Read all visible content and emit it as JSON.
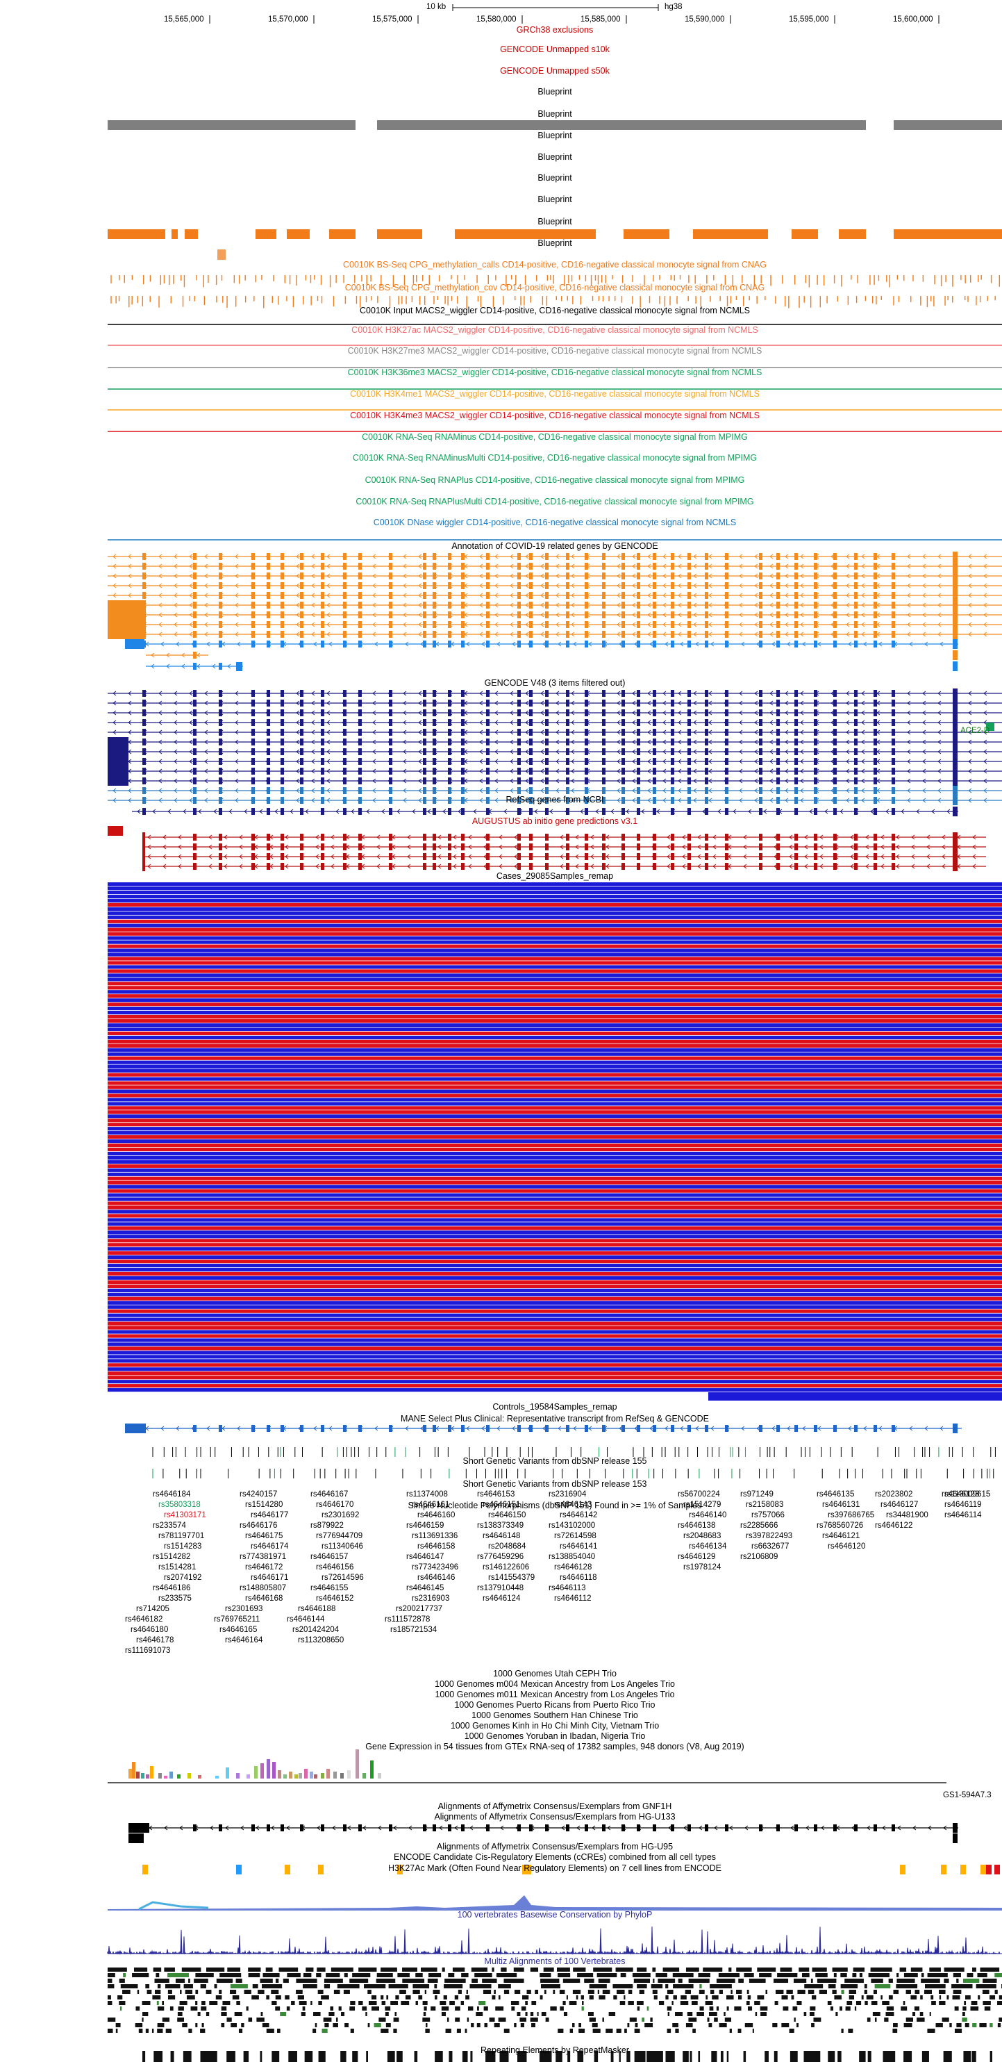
{
  "ruler": {
    "scale_label": "10 kb",
    "assembly": "hg38",
    "ticks": [
      "15,565,000",
      "15,570,000",
      "15,575,000",
      "15,580,000",
      "15,585,000",
      "15,590,000",
      "15,595,000",
      "15,600,000"
    ]
  },
  "tracks": [
    {
      "label": "GRCh38 exclusions",
      "color": "#cc0000"
    },
    {
      "label": "GENCODE Unmapped s10k",
      "color": "#cc0000"
    },
    {
      "label": "GENCODE Unmapped s50k",
      "color": "#cc0000"
    },
    {
      "label": "Blueprint",
      "color": "#000000"
    },
    {
      "label": "Blueprint",
      "color": "#000000"
    },
    {
      "label": "Blueprint",
      "color": "#000000"
    },
    {
      "label": "Blueprint",
      "color": "#000000"
    },
    {
      "label": "Blueprint",
      "color": "#000000"
    },
    {
      "label": "Blueprint",
      "color": "#000000"
    },
    {
      "label": "Blueprint",
      "color": "#000000"
    },
    {
      "label": "Blueprint",
      "color": "#000000"
    },
    {
      "label": "C0010K BS-Seq CPG_methylation_calls CD14-positive, CD16-negative classical monocyte signal from CNAG",
      "color": "#f07a1a"
    },
    {
      "label": "C0010K BS-Seq CPG_methylation_cov CD14-positive, CD16-negative classical monocyte signal from CNAG",
      "color": "#f07a1a"
    },
    {
      "label": "C0010K Input MACS2_wiggler CD14-positive, CD16-negative classical monocyte signal from NCMLS",
      "color": "#000000"
    },
    {
      "label": "C0010K H3K27ac MACS2_wiggler CD14-positive, CD16-negative classical monocyte signal from NCMLS",
      "color": "#f26b6b"
    },
    {
      "label": "C0010K H3K27me3 MACS2_wiggler CD14-positive, CD16-negative classical monocyte signal from NCMLS",
      "color": "#888888"
    },
    {
      "label": "C0010K H3K36me3 MACS2_wiggler CD14-positive, CD16-negative classical monocyte signal from NCMLS",
      "color": "#12a05a"
    },
    {
      "label": "C0010K H3K4me1 MACS2_wiggler CD14-positive, CD16-negative classical monocyte signal from NCMLS",
      "color": "#f5a623"
    },
    {
      "label": "C0010K H3K4me3 MACS2_wiggler CD14-positive, CD16-negative classical monocyte signal from NCMLS",
      "color": "#e0101a"
    },
    {
      "label": "C0010K RNA-Seq RNAMinus CD14-positive, CD16-negative classical monocyte signal from MPIMG",
      "color": "#12a05a"
    },
    {
      "label": "C0010K RNA-Seq RNAMinusMulti CD14-positive, CD16-negative classical monocyte signal from MPIMG",
      "color": "#12a05a"
    },
    {
      "label": "C0010K RNA-Seq RNAPlus CD14-positive, CD16-negative classical monocyte signal from MPIMG",
      "color": "#12a05a"
    },
    {
      "label": "C0010K RNA-Seq RNAPlusMulti CD14-positive, CD16-negative classical monocyte signal from MPIMG",
      "color": "#12a05a"
    },
    {
      "label": "C0010K DNase wiggler CD14-positive, CD16-negative classical monocyte signal from NCMLS",
      "color": "#1a78c2"
    },
    {
      "label": "Annotation of COVID-19 related genes by GENCODE",
      "color": "#000000"
    },
    {
      "label": "GENCODE V48 (3 items filtered out)",
      "color": "#000000"
    },
    {
      "label": "RefSeq genes from NCBI",
      "color": "#000000"
    },
    {
      "label": "AUGUSTUS ab initio gene predictions v3.1",
      "color": "#cc0000"
    },
    {
      "label": "Cases_29085Samples_remap",
      "color": "#000000"
    },
    {
      "label": "Controls_19584Samples_remap",
      "color": "#000000"
    },
    {
      "label": "MANE Select Plus Clinical: Representative transcript from RefSeq & GENCODE",
      "color": "#000000"
    },
    {
      "label": "Short Genetic Variants from dbSNP release 155",
      "color": "#000000"
    },
    {
      "label": "Short Genetic Variants from dbSNP release 153",
      "color": "#000000"
    },
    {
      "label": "Simple Nucleotide Polymorphisms (dbSNP 151) Found in >= 1% of Samples",
      "color": "#000000"
    },
    {
      "label": "1000 Genomes Utah CEPH Trio",
      "color": "#000000"
    },
    {
      "label": "1000 Genomes m004 Mexican Ancestry from Los Angeles Trio",
      "color": "#000000"
    },
    {
      "label": "1000 Genomes m011 Mexican Ancestry from Los Angeles Trio",
      "color": "#000000"
    },
    {
      "label": "1000 Genomes Puerto Ricans from Puerto Rico Trio",
      "color": "#000000"
    },
    {
      "label": "1000 Genomes Southern Han Chinese Trio",
      "color": "#000000"
    },
    {
      "label": "1000 Genomes Kinh in Ho Chi Minh City, Vietnam Trio",
      "color": "#000000"
    },
    {
      "label": "1000 Genomes Yoruban in Ibadan, Nigeria Trio",
      "color": "#000000"
    },
    {
      "label": "Gene Expression in 54 tissues from GTEx RNA-seq of 17382 samples, 948 donors (V8, Aug 2019)",
      "color": "#000000"
    },
    {
      "label": "Alignments of Affymetrix Consensus/Exemplars from GNF1H",
      "color": "#000000"
    },
    {
      "label": "Alignments of Affymetrix Consensus/Exemplars from HG-U133",
      "color": "#000000"
    },
    {
      "label": "Alignments of Affymetrix Consensus/Exemplars from HG-U95",
      "color": "#000000"
    },
    {
      "label": "ENCODE Candidate Cis-Regulatory Elements (cCREs) combined from all cell types",
      "color": "#000000"
    },
    {
      "label": "H3K27Ac Mark (Often Found Near Regulatory Elements) on 7 cell lines from ENCODE",
      "color": "#000000"
    },
    {
      "label": "100 vertebrates Basewise Conservation by PhyloP",
      "color": "#3030a0"
    },
    {
      "label": "Multiz Alignments of 100 Vertebrates",
      "color": "#3030a0"
    },
    {
      "label": "Repeating Elements by RepeatMasker",
      "color": "#000000"
    }
  ],
  "gene_labels": {
    "ace2": "ACE2-D",
    "gtex_gene": "GS1-594A7.3"
  },
  "snps": [
    [
      "rs4646184",
      "rs4240157",
      "rs4646167",
      "rs11374008",
      "rs4646153",
      "rs2316904",
      "rs56700224",
      "rs971249",
      "rs4646135",
      "rs2023802",
      "rs4646123",
      "rs113009615"
    ],
    [
      "rs35803318",
      "rs1514280",
      "rs4646170",
      "rs4646161",
      "rs4646151",
      "rs4646143",
      "rs1514279",
      "rs2158083",
      "rs4646131",
      "rs4646127",
      "rs4646119"
    ],
    [
      "rs41303171",
      "rs4646177",
      "rs2301692",
      "rs4646160",
      "rs4646150",
      "rs4646142",
      "rs4646140",
      "rs757066",
      "rs397686765",
      "rs34481900",
      "rs4646114"
    ],
    [
      "rs233574",
      "rs4646176",
      "rs879922",
      "rs4646159",
      "rs138373349",
      "rs143102000",
      "rs4646138",
      "rs2285666",
      "rs768560726",
      "rs4646122"
    ],
    [
      "rs781197701",
      "rs4646175",
      "rs776944709",
      "rs113691336",
      "rs4646148",
      "rs72614598",
      "rs2048683",
      "rs397822493",
      "rs4646121"
    ],
    [
      "rs1514283",
      "rs4646174",
      "rs11340646",
      "rs4646158",
      "rs2048684",
      "rs4646141",
      "rs4646134",
      "rs6632677",
      "rs4646120"
    ],
    [
      "rs1514282",
      "rs774381971",
      "rs4646157",
      "rs4646147",
      "rs776459296",
      "rs138854040",
      "rs4646129",
      "rs2106809"
    ],
    [
      "rs1514281",
      "rs4646172",
      "rs4646156",
      "rs773423496",
      "rs146122606",
      "rs4646128",
      "rs1978124"
    ],
    [
      "rs2074192",
      "rs4646171",
      "rs72614596",
      "rs4646146",
      "rs141554379",
      "rs4646118"
    ],
    [
      "rs4646186",
      "rs148805807",
      "rs4646155",
      "rs4646145",
      "rs137910448",
      "rs4646113"
    ],
    [
      "rs233575",
      "rs4646168",
      "rs4646152",
      "rs2316903",
      "rs4646124",
      "rs4646112"
    ],
    [
      "rs714205",
      "rs2301693",
      "rs4646188",
      "rs200217737"
    ],
    [
      "rs4646182",
      "rs769765211",
      "rs4646144",
      "rs111572878"
    ],
    [
      "rs4646180",
      "rs4646165",
      "rs201424204",
      "rs185721534"
    ],
    [
      "rs4646178",
      "rs4646164",
      "rs113208650"
    ],
    [
      "rs111691073"
    ]
  ]
}
